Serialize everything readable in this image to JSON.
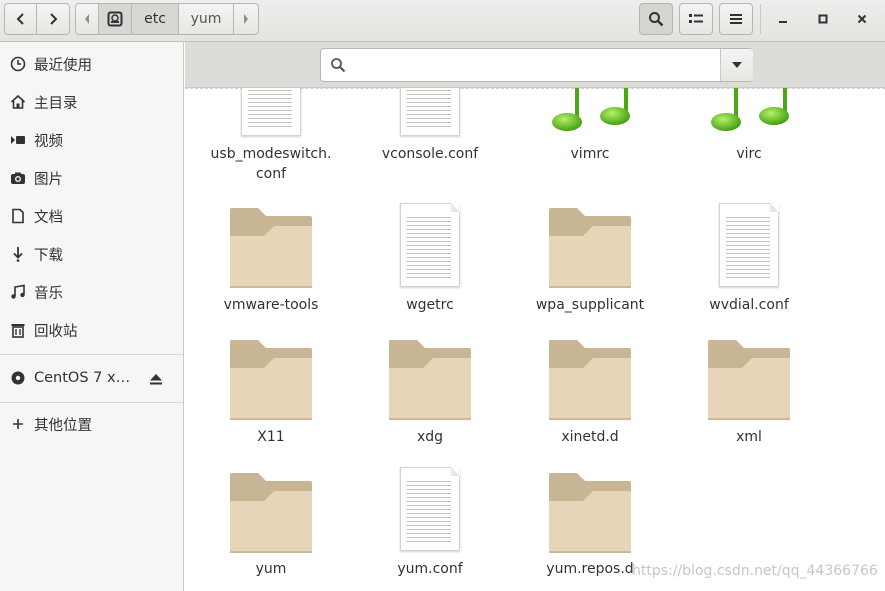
{
  "header": {
    "path_segments": [
      "etc",
      "yum"
    ],
    "buttons": {
      "back": "go-previous-icon",
      "forward": "go-next-icon",
      "search": "search-icon",
      "view": "view-list-icon",
      "menu": "open-menu-icon"
    }
  },
  "sidebar": {
    "items": [
      {
        "label": "最近使用",
        "icon": "recent-icon"
      },
      {
        "label": "主目录",
        "icon": "home-icon"
      },
      {
        "label": "视频",
        "icon": "video-icon"
      },
      {
        "label": "图片",
        "icon": "picture-icon"
      },
      {
        "label": "文档",
        "icon": "document-icon"
      },
      {
        "label": "下载",
        "icon": "download-icon"
      },
      {
        "label": "音乐",
        "icon": "music-icon"
      },
      {
        "label": "回收站",
        "icon": "trash-icon"
      }
    ],
    "devices": [
      {
        "label": "CentOS 7 x…",
        "icon": "disc-icon",
        "action": "eject-icon"
      }
    ],
    "other": {
      "label": "其他位置",
      "icon": "plus-icon"
    }
  },
  "search": {
    "placeholder": "",
    "value": ""
  },
  "files": [
    {
      "name": "usb_modeswitch.\nconf",
      "type": "document"
    },
    {
      "name": "vconsole.conf",
      "type": "document"
    },
    {
      "name": "vimrc",
      "type": "audio"
    },
    {
      "name": "virc",
      "type": "audio"
    },
    {
      "name": "vmware-tools",
      "type": "folder"
    },
    {
      "name": "wgetrc",
      "type": "document"
    },
    {
      "name": "wpa_supplicant",
      "type": "folder"
    },
    {
      "name": "wvdial.conf",
      "type": "document"
    },
    {
      "name": "X11",
      "type": "folder"
    },
    {
      "name": "xdg",
      "type": "folder"
    },
    {
      "name": "xinetd.d",
      "type": "folder"
    },
    {
      "name": "xml",
      "type": "folder"
    },
    {
      "name": "yum",
      "type": "folder"
    },
    {
      "name": "yum.conf",
      "type": "document"
    },
    {
      "name": "yum.repos.d",
      "type": "folder"
    }
  ],
  "watermark": "https://blog.csdn.net/qq_44366766",
  "colors": {
    "folder": "#e8d5b9",
    "folder_tab": "#c7b594",
    "note": "#5ac00f"
  }
}
